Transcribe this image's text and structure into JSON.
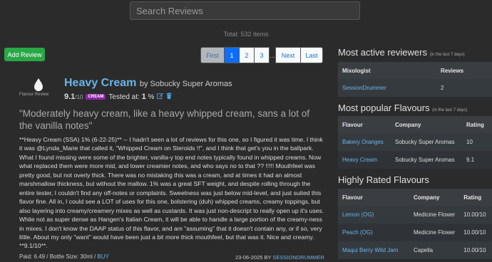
{
  "search": {
    "placeholder": "Search Reviews"
  },
  "total_label": "Total: 532 items",
  "add_review_label": "Add Review",
  "pagination": {
    "first": "First",
    "pages": [
      "1",
      "2",
      "3"
    ],
    "active": "1",
    "ellipsis": "...",
    "next": "Next",
    "last": "Last"
  },
  "review": {
    "logo_label": "Flavour Review",
    "flavour": "Heavy Cream",
    "by": "by Sobucky Super Aromas",
    "score": "9.1",
    "out_of": "/10",
    "badge": "CREAM",
    "tested_at": "Tested at:",
    "tested_value": "1",
    "tested_unit": "%",
    "quote": "\"Moderately heavy cream, like a heavy whipped cream, sans a lot of the vanilla notes\"",
    "body": "**Heavy Cream (SSA) 1% (6-22-25)** -- I hadn't seen a lot of reviews for this one, so I figured it was time. I think it was @Lynda_Marie that called it, \"Whipped Cream on Steroids !!\", and I think that get's you in the ballpark. What I found missing were some of the brighter, vanilla-y top end notes typically found in whipped creams. Now what replaced them were more mid, and lower creamier notes, and who says no to that ?? !!!!! Mouthfeel was pretty good, but not overly thick. There was no mistaking this was a cream, and at times it had an almost marshmallow thickness, but without the mallow. 1% was a great SFT weight, and despite rolling through the entire tester, I couldn't find any off-notes or complaints. Sweetness was just below mid-level, and just suited this flavor fine. All in, I could see a LOT of uses for this one, bolstering (duh) whipped creams, creamy toppings, but also layering into creamy/creamery mixes as well as custards. It was just non-descript to really open up it's uses. While not as super dense as Hangen's Italian Cream, it will be able to handle a large portion of the creamy-ness in mixes. I don't know the DAAP status of this flavor, and am \"assuming\" that it doesn't contain any, or if so, very little. About my only \"want\" would have been just a bit more thick mouthfeel, but that was it. Nice and creamy. **9.1/10**.",
    "paid": "Paid: 6.49 / Bottle Size: 30ml /",
    "buy": "BUY",
    "date": "23-06-2025 BY",
    "reviewer": "SESSIONDRUMMER"
  },
  "most_active": {
    "title": "Most active reviewers",
    "subtitle": "(in the last 7 days)",
    "headers": [
      "Mixologist",
      "Reviews"
    ],
    "rows": [
      [
        "SessionDrummer",
        "2"
      ]
    ]
  },
  "most_popular": {
    "title": "Most popular Flavours",
    "subtitle": "(in the last 7 days)",
    "headers": [
      "Flavour",
      "Company",
      "Rating"
    ],
    "rows": [
      [
        "Bakery Oranges",
        "Sobucky Super Aromas",
        "10"
      ],
      [
        "Heavy Cream",
        "Sobucky Super Aromas",
        "9.1"
      ]
    ]
  },
  "highly_rated": {
    "title": "Highly Rated Flavours",
    "headers": [
      "Flavour",
      "Company",
      "Rating"
    ],
    "rows": [
      [
        "Lemon (OG)",
        "Medicine Flower",
        "10.00/10"
      ],
      [
        "Peach (OG)",
        "Medicine Flower",
        "10.00/10"
      ],
      [
        "Maqui Berry Wild Jam",
        "Capella",
        "10.00/10"
      ]
    ]
  },
  "colors": {
    "accent": "#6ab4e8",
    "add": "#28a745",
    "active_page": "#0d6efd",
    "badge": "#8e24aa"
  }
}
